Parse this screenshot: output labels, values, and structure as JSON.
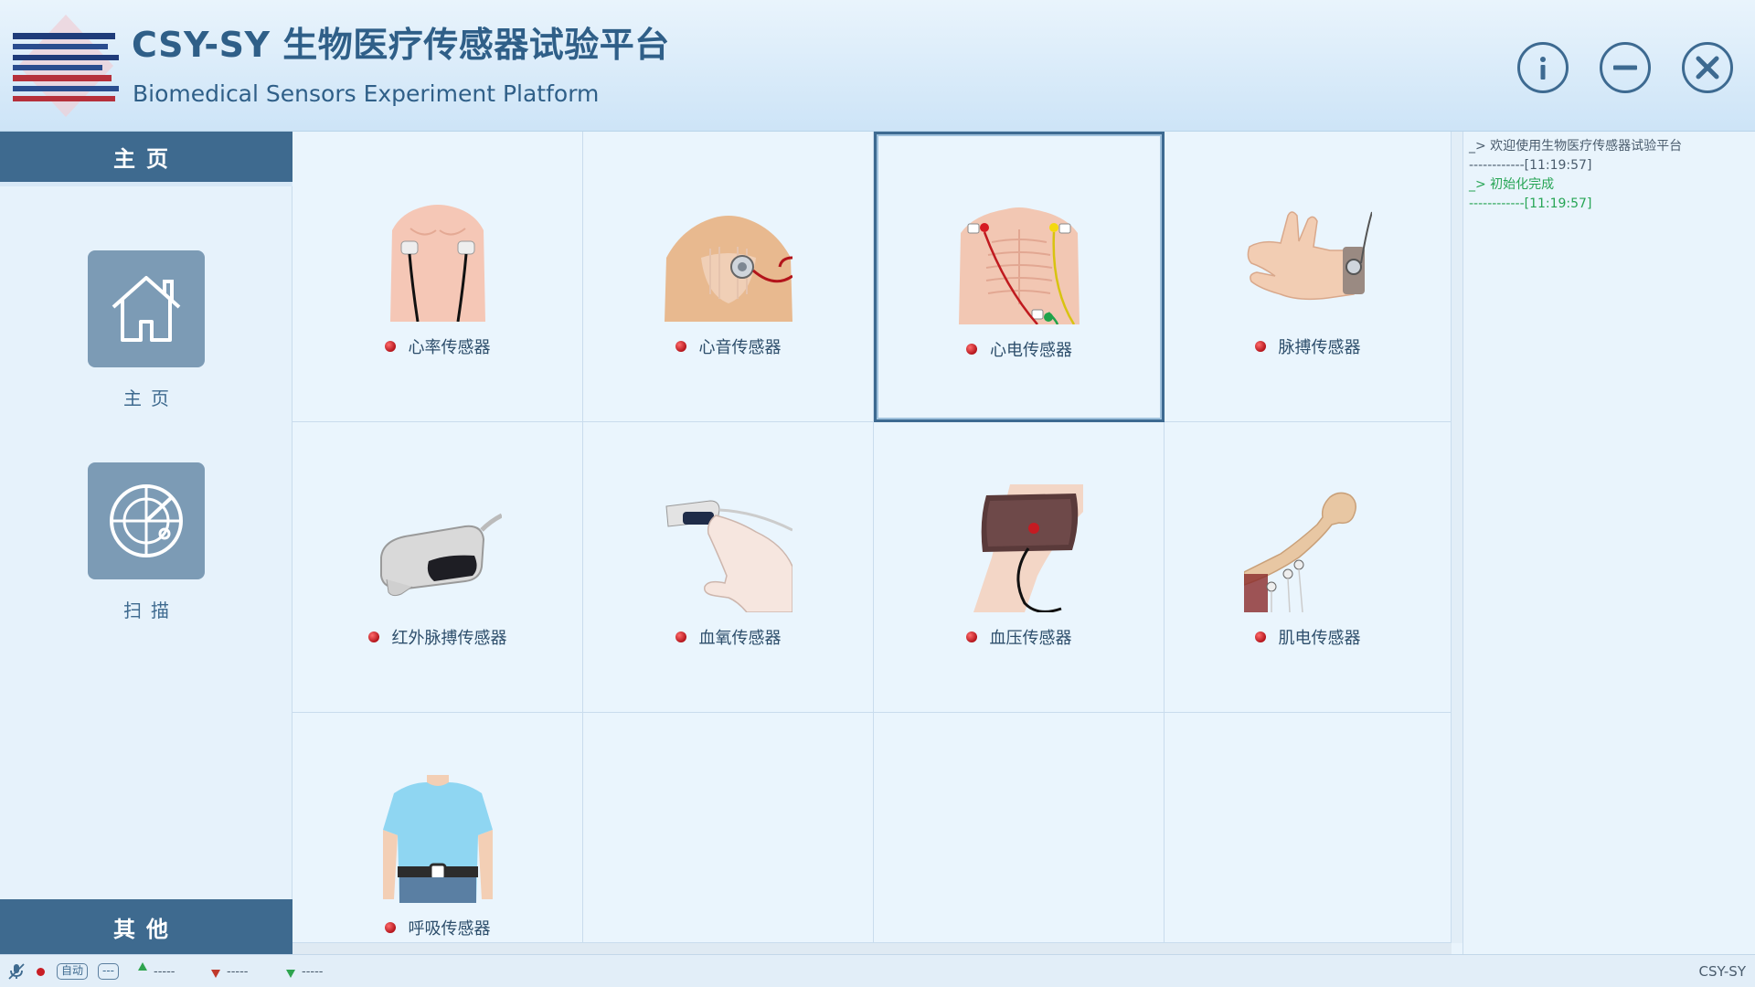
{
  "header": {
    "title": "CSY-SY 生物医疗传感器试验平台",
    "subtitle": "Biomedical Sensors Experiment Platform",
    "buttons": [
      {
        "name": "info-icon"
      },
      {
        "name": "minimize-icon"
      },
      {
        "name": "close-icon"
      }
    ]
  },
  "sidebar": {
    "header_label": "主页",
    "footer_label": "其他",
    "items": [
      {
        "label": "主页",
        "icon": "home-icon"
      },
      {
        "label": "扫描",
        "icon": "radar-scan-icon"
      }
    ]
  },
  "sensors": [
    {
      "label": "心率传感器",
      "icon": "heart-rate-sensor-image",
      "status_color": "#c81e25"
    },
    {
      "label": "心音传感器",
      "icon": "heart-sound-sensor-image",
      "status_color": "#c81e25"
    },
    {
      "label": "心电传感器",
      "icon": "ecg-sensor-image",
      "status_color": "#c81e25",
      "selected": true
    },
    {
      "label": "脉搏传感器",
      "icon": "pulse-sensor-image",
      "status_color": "#c81e25"
    },
    {
      "label": "红外脉搏传感器",
      "icon": "infrared-pulse-sensor-image",
      "status_color": "#c81e25"
    },
    {
      "label": "血氧传感器",
      "icon": "blood-oxygen-sensor-image",
      "status_color": "#c81e25"
    },
    {
      "label": "血压传感器",
      "icon": "blood-pressure-sensor-image",
      "status_color": "#c81e25"
    },
    {
      "label": "肌电传感器",
      "icon": "emg-sensor-image",
      "status_color": "#c81e25"
    },
    {
      "label": "呼吸传感器",
      "icon": "respiration-sensor-image",
      "status_color": "#c81e25"
    }
  ],
  "log": [
    {
      "message": "_> 欢迎使用生物医疗传感器试验平台",
      "timestamp": "------------[11:19:57]",
      "type": "info"
    },
    {
      "message": "_> 初始化完成",
      "timestamp": "------------[11:19:57]",
      "type": "ok"
    }
  ],
  "statusbar": {
    "mode_label": "自动",
    "port_label": "---",
    "up_value": "-----",
    "down_value": "-----",
    "down2_value": "-----",
    "app_name": "CSY-SY",
    "colors": {
      "up": "#2ea44f",
      "down": "#c0392b",
      "down2": "#2ea44f",
      "dot": "#c81e25"
    }
  }
}
